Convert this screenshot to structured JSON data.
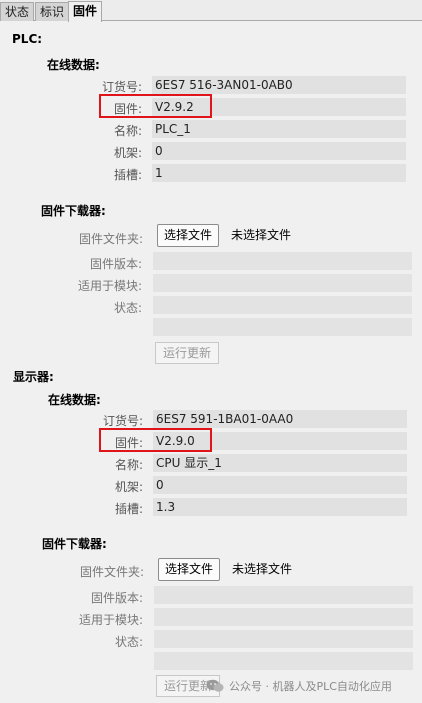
{
  "tabs": [
    {
      "label": "状态",
      "active": false
    },
    {
      "label": "标识",
      "active": false
    },
    {
      "label": "固件",
      "active": true
    }
  ],
  "plc": {
    "title": "PLC:",
    "online_heading": "在线数据:",
    "fields": {
      "order_label": "订货号:",
      "order_value": "6ES7 516-3AN01-0AB0",
      "firmware_label": "固件:",
      "firmware_value": "V2.9.2",
      "name_label": "名称:",
      "name_value": "PLC_1",
      "rack_label": "机架:",
      "rack_value": "0",
      "slot_label": "插槽:",
      "slot_value": "1"
    },
    "loader": {
      "heading": "固件下载器:",
      "folder_label": "固件文件夹:",
      "choose_button": "选择文件",
      "no_file_text": "未选择文件",
      "version_label": "固件版本:",
      "module_label": "适用于模块:",
      "status_label": "状态:",
      "run_update_button": "运行更新"
    }
  },
  "display": {
    "title": "显示器:",
    "online_heading": "在线数据:",
    "fields": {
      "order_label": "订货号:",
      "order_value": "6ES7 591-1BA01-0AA0",
      "firmware_label": "固件:",
      "firmware_value": "V2.9.0",
      "name_label": "名称:",
      "name_value": "CPU 显示_1",
      "rack_label": "机架:",
      "rack_value": "0",
      "slot_label": "插槽:",
      "slot_value": "1.3"
    },
    "loader": {
      "heading": "固件下载器:",
      "folder_label": "固件文件夹:",
      "choose_button": "选择文件",
      "no_file_text": "未选择文件",
      "version_label": "固件版本:",
      "module_label": "适用于模块:",
      "status_label": "状态:",
      "run_update_button": "运行更新"
    }
  },
  "watermark": "公众号 · 机器人及PLC自动化应用",
  "colors": {
    "highlight": "#e0151b",
    "field_bg": "#e1e1e1",
    "panel_bg": "#f0f0f0"
  }
}
